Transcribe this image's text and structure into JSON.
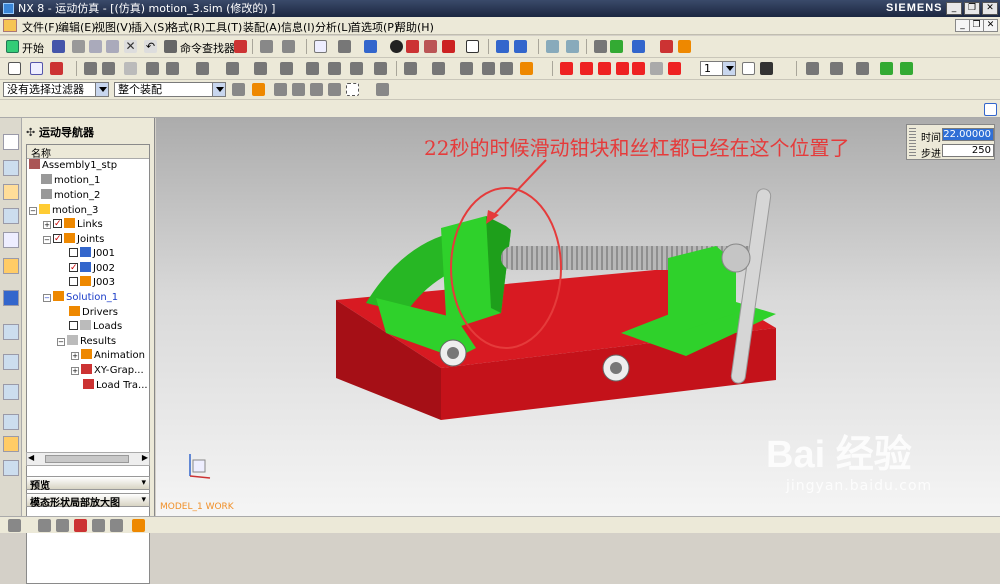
{
  "window": {
    "title": "NX 8 - 运动仿真 - [(仿真) motion_3.sim  (修改的)  ]",
    "brand": "SIEMENS",
    "buttons": [
      "_",
      "❐",
      "✕"
    ]
  },
  "menu": {
    "items": [
      "文件(F)",
      "编辑(E)",
      "视图(V)",
      "插入(S)",
      "格式(R)",
      "工具(T)",
      "装配(A)",
      "信息(I)",
      "分析(L)",
      "首选项(P)",
      "帮助(H)"
    ]
  },
  "toolbar1": {
    "start_label": "开始",
    "command_finder": "命令查找器"
  },
  "toolbar3": {
    "filter_value": "没有选择过滤器",
    "assembly_value": "整个装配",
    "step_value": "1"
  },
  "navigator": {
    "title": "运动导航器",
    "column": "名称",
    "tree": [
      {
        "label": "Assembly1_stp",
        "level": 0,
        "icon": "assembly-icon"
      },
      {
        "label": "motion_1",
        "level": 1,
        "icon": "sim-icon"
      },
      {
        "label": "motion_2",
        "level": 1,
        "icon": "sim-icon"
      },
      {
        "label": "motion_3",
        "level": 1,
        "icon": "sim-icon",
        "expanded": true
      },
      {
        "label": "Links",
        "level": 2,
        "icon": "link-icon",
        "checked": true,
        "expandable": true
      },
      {
        "label": "Joints",
        "level": 2,
        "icon": "joint-icon",
        "checked": true,
        "expanded": true
      },
      {
        "label": "J001",
        "level": 3,
        "icon": "joint-icon"
      },
      {
        "label": "J002",
        "level": 3,
        "icon": "joint-icon",
        "checked": true
      },
      {
        "label": "J003",
        "level": 3,
        "icon": "joint-icon"
      },
      {
        "label": "Solution_1",
        "level": 2,
        "icon": "solution-icon",
        "expanded": true,
        "active": true
      },
      {
        "label": "Drivers",
        "level": 3,
        "icon": "driver-icon"
      },
      {
        "label": "Loads",
        "level": 3,
        "icon": "load-icon"
      },
      {
        "label": "Results",
        "level": 3,
        "icon": "results-icon",
        "expanded": true
      },
      {
        "label": "Animation",
        "level": 4,
        "icon": "animation-icon",
        "expandable": true
      },
      {
        "label": "XY-Grap...",
        "level": 4,
        "icon": "graph-icon",
        "expandable": true
      },
      {
        "label": "Load Tra...",
        "level": 4,
        "icon": "load-icon"
      }
    ],
    "panels": [
      "预览",
      "模态形状局部放大图"
    ]
  },
  "viewport": {
    "annotation": "22秒的时候滑动钳块和丝杠都已经在这个位置了",
    "time_label": "时间",
    "time_value": "22.00000",
    "step_label": "步进",
    "step_value": "250",
    "status": "MODEL_1 WORK",
    "watermark": "Bai 经验",
    "watermark_url": "jingyan.baidu.com"
  },
  "colors": {
    "vise_green": "#2fd12b",
    "base_red": "#c4121a",
    "annotation_red": "#e53b3b"
  }
}
